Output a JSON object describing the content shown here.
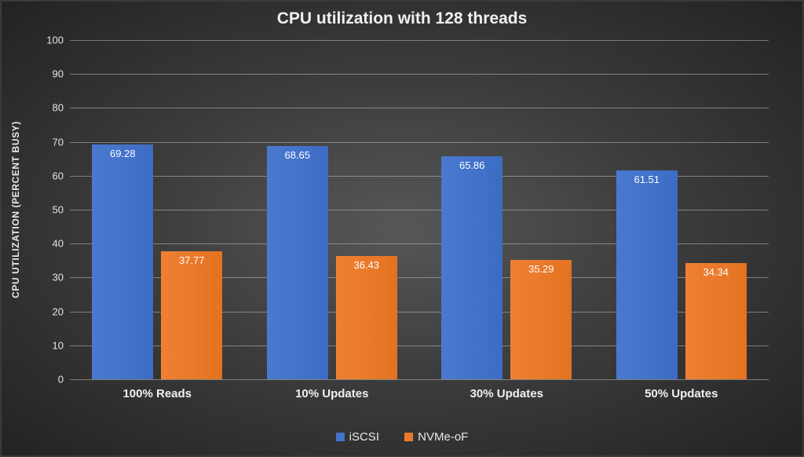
{
  "chart_data": {
    "type": "bar",
    "title": "CPU utilization with 128 threads",
    "ylabel": "CPU UTILIZATION (PERCENT BUSY)",
    "xlabel": "",
    "ylim": [
      0,
      100
    ],
    "yticks": [
      0,
      10,
      20,
      30,
      40,
      50,
      60,
      70,
      80,
      90,
      100
    ],
    "categories": [
      "100% Reads",
      "10% Updates",
      "30% Updates",
      "50% Updates"
    ],
    "series": [
      {
        "name": "iSCSI",
        "color": "#4373cb",
        "values": [
          69.28,
          68.65,
          65.86,
          61.51
        ]
      },
      {
        "name": "NVMe-oF",
        "color": "#ea7a2a",
        "values": [
          37.77,
          36.43,
          35.29,
          34.34
        ]
      }
    ]
  }
}
